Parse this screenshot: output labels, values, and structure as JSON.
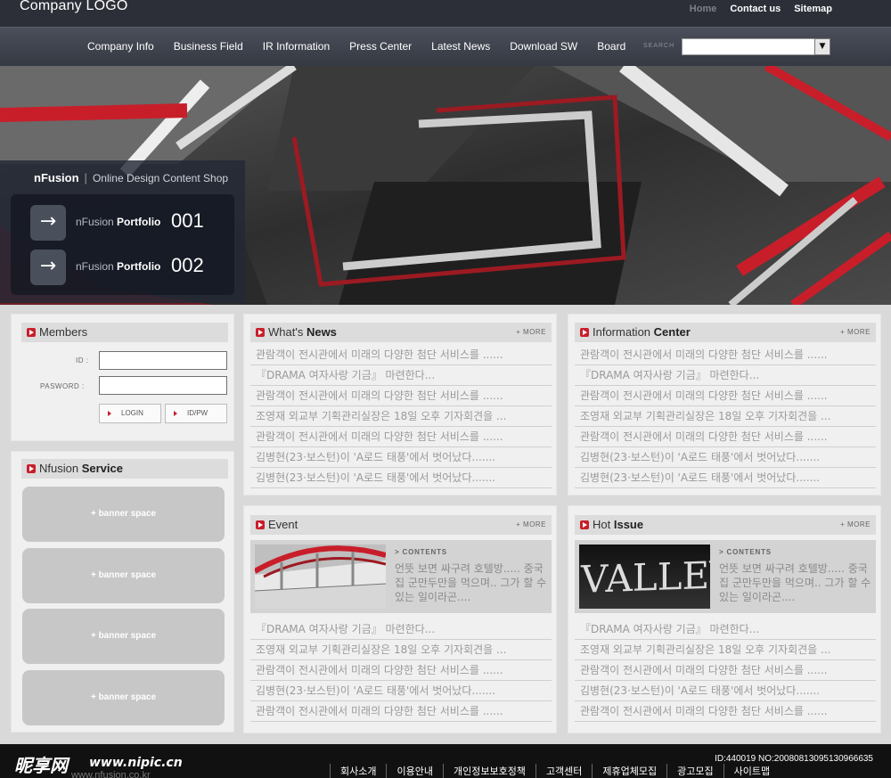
{
  "header": {
    "logo": "Company LOGO",
    "links": [
      "Home",
      "Contact us",
      "Sitemap"
    ]
  },
  "nav": {
    "items": [
      "Company Info",
      "Business Field",
      "IR Information",
      "Press Center",
      "Latest News",
      "Download SW",
      "Board"
    ],
    "search_label": "SEARCH",
    "search_value": "",
    "search_dropdown_icon": "triangle-down"
  },
  "hero": {
    "brand": "nFusion",
    "tagline": "Online Design Content Shop",
    "portfolio": [
      {
        "prefix": "nFusion",
        "label": "Portfolio",
        "number": "001"
      },
      {
        "prefix": "nFusion",
        "label": "Portfolio",
        "number": "002"
      }
    ]
  },
  "members": {
    "title": "Members",
    "id_label": "ID :",
    "pw_label": "PASWORD :",
    "login_label": "LOGIN",
    "idpw_label": "ID/PW"
  },
  "service": {
    "title_prefix": "Nfusion",
    "title_bold": "Service",
    "banners": [
      "+ banner space",
      "+ banner space",
      "+ banner space",
      "+ banner space"
    ]
  },
  "news": {
    "title_prefix": "What's",
    "title_bold": "News",
    "more": "+ MORE",
    "items": [
      "관람객이 전시관에서 미래의 다양한 첨단 서비스를 ......",
      "『DRAMA 여자사랑 기금』 마련한다...",
      "관람객이 전시관에서 미래의 다양한 첨단 서비스를 ......",
      "조영재 외교부 기획관리실장은 18일 오후 기자회견을 ...",
      "관람객이 전시관에서 미래의 다양한 첨단 서비스를 ......",
      "김병현(23·보스턴)이 'A로드 태풍'에서 벗어났다.......",
      "김병현(23·보스턴)이 'A로드 태풍'에서 벗어났다......."
    ]
  },
  "info": {
    "title_prefix": "Information",
    "title_bold": "Center",
    "more": "+ MORE",
    "items": [
      "관람객이 전시관에서 미래의 다양한 첨단 서비스를 ......",
      "『DRAMA 여자사랑 기금』 마련한다...",
      "관람객이 전시관에서 미래의 다양한 첨단 서비스를 ......",
      "조영재 외교부 기획관리실장은 18일 오후 기자회견을 ...",
      "관람객이 전시관에서 미래의 다양한 첨단 서비스를 ......",
      "김병현(23·보스턴)이 'A로드 태풍'에서 벗어났다.......",
      "김병현(23·보스턴)이 'A로드 태풍'에서 벗어났다......."
    ]
  },
  "event": {
    "title": "Event",
    "more": "+ MORE",
    "contents_tag": "> CONTENTS",
    "contents_text": "언뜻 보면 싸구려 호텔방..... 중국집 군만두만을 먹으며.. 그가 할 수 있는 일이라곤....",
    "items": [
      "『DRAMA 여자사랑 기금』 마련한다...",
      "조영재 외교부 기획관리실장은 18일 오후 기자회견을 ...",
      "관람객이 전시관에서 미래의 다양한 첨단 서비스를 ......",
      "김병현(23·보스턴)이 'A로드 태풍'에서 벗어났다.......",
      "관람객이 전시관에서 미래의 다양한 첨단 서비스를 ......"
    ]
  },
  "hot": {
    "title_prefix": "Hot",
    "title_bold": "Issue",
    "more": "+ MORE",
    "contents_tag": "> CONTENTS",
    "contents_text": "언뜻 보면 싸구려 호텔방..... 중국집 군만두만을 먹으며.. 그가 할 수 있는 일이라곤....",
    "image_text": "VALLEY",
    "items": [
      "『DRAMA 여자사랑 기금』 마련한다...",
      "조영재 외교부 기획관리실장은 18일 오후 기자회견을 ...",
      "관람객이 전시관에서 미래의 다양한 첨단 서비스를 ......",
      "김병현(23·보스턴)이 'A로드 태풍'에서 벗어났다.......",
      "관람객이 전시관에서 미래의 다양한 첨단 서비스를 ......"
    ]
  },
  "footer": {
    "logo": "昵享网",
    "site": "www.nipic.cn",
    "sub": "www.nfusion.co.kr",
    "id_text": "ID:440019 NO:20080813095130966635",
    "links": [
      "회사소개",
      "이용안내",
      "개인정보보호정책",
      "고객센터",
      "제휴업체모집",
      "광고모집",
      "사이트맵"
    ]
  },
  "colors": {
    "accent": "#c81e2a",
    "topbar": "#2c2f37",
    "panel_bg": "#f0f0f0",
    "panel_head": "#dcdcdc"
  }
}
